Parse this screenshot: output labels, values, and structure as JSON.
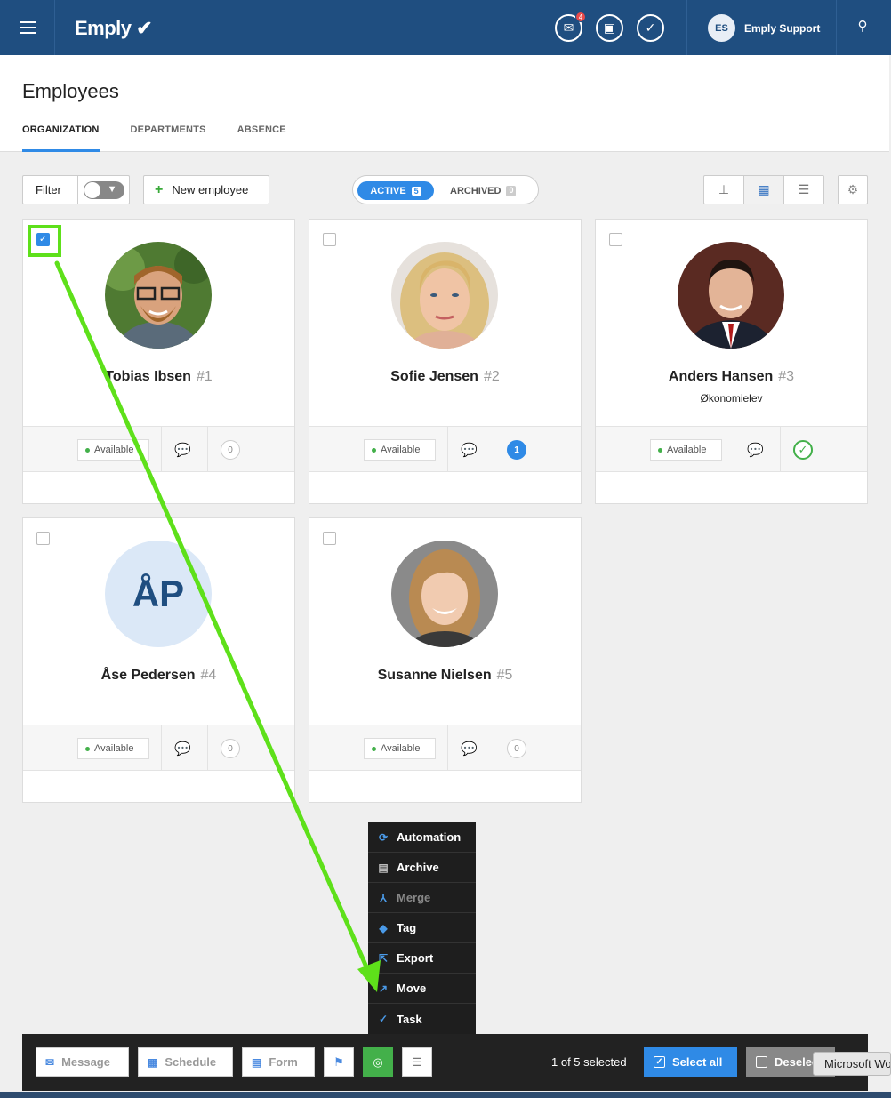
{
  "topbar": {
    "logo": "Emply",
    "mail_badge": "4",
    "user_initials": "ES",
    "user_name": "Emply Support"
  },
  "header": {
    "title": "Employees",
    "tabs": [
      "ORGANIZATION",
      "DEPARTMENTS",
      "ABSENCE"
    ]
  },
  "toolbar": {
    "filter_label": "Filter",
    "new_employee_label": "New employee",
    "active_label": "ACTIVE",
    "active_count": "5",
    "archived_label": "ARCHIVED",
    "archived_count": "0"
  },
  "employees": [
    {
      "name": "Tobias Ibsen",
      "number": "#1",
      "role": "",
      "status": "Available",
      "count": "0",
      "checked": true
    },
    {
      "name": "Sofie Jensen",
      "number": "#2",
      "role": "",
      "status": "Available",
      "count": "1",
      "checked": false
    },
    {
      "name": "Anders Hansen",
      "number": "#3",
      "role": "Økonomielev",
      "status": "Available",
      "count": "✓",
      "checked": false
    },
    {
      "name": "Åse Pedersen",
      "number": "#4",
      "role": "",
      "status": "Available",
      "count": "0",
      "initials": "ÅP",
      "checked": false
    },
    {
      "name": "Susanne Nielsen",
      "number": "#5",
      "role": "",
      "status": "Available",
      "count": "0",
      "checked": false
    }
  ],
  "menu": {
    "items": [
      "Automation",
      "Archive",
      "Merge",
      "Tag",
      "Export",
      "Move",
      "Task"
    ]
  },
  "bottombar": {
    "message_label": "Message",
    "schedule_label": "Schedule",
    "form_label": "Form",
    "selected_text": "1 of 5 selected",
    "select_all_label": "Select all",
    "deselect_label": "Deselect all",
    "tooltip": "Microsoft Word"
  },
  "colors": {
    "topbar": "#1f4e80",
    "accent": "#2f8ae6",
    "available": "#43b04a",
    "annotation": "#5ee01a"
  }
}
